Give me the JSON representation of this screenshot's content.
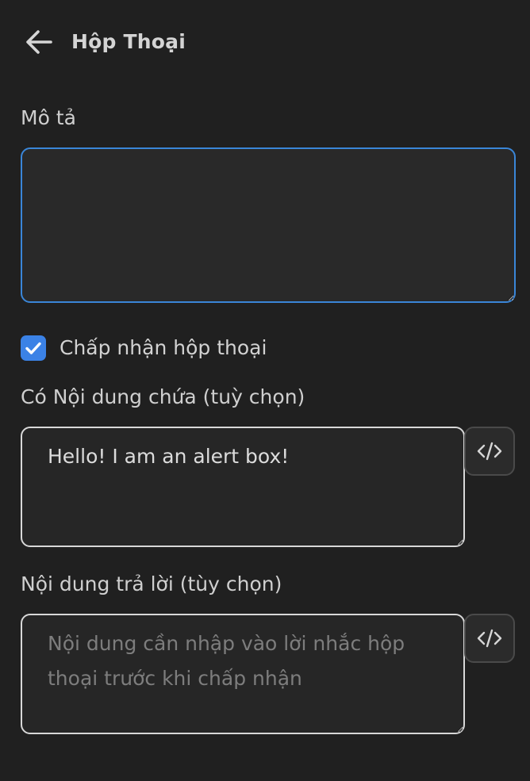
{
  "header": {
    "title": "Hộp Thoại",
    "back_icon": "arrow-left-icon"
  },
  "description": {
    "label": "Mô tả",
    "value": ""
  },
  "accept_dialog": {
    "label": "Chấp nhận hộp thoại",
    "checked": true,
    "check_color": "#3b82e6"
  },
  "content": {
    "label": "Có Nội dung chứa (tuỳ chọn)",
    "value": "Hello! I am an alert box!",
    "code_icon": "code-icon"
  },
  "reply": {
    "label": "Nội dung trả lời (tùy chọn)",
    "placeholder": "Nội dung cần nhập vào lời nhắc hộp thoại trước khi chấp nhận",
    "value": "",
    "code_icon": "code-icon"
  },
  "colors": {
    "background": "#202020",
    "focus_border": "#3a86d8",
    "accent": "#3b82e6"
  }
}
